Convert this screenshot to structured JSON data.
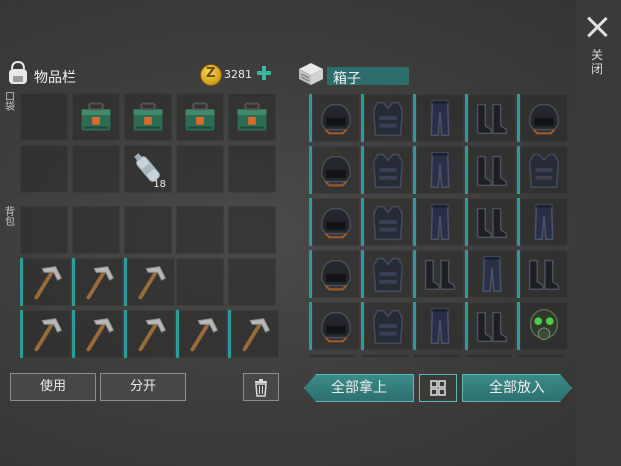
{
  "inventory": {
    "title": "物品栏",
    "coins": "3281",
    "pockets_label": "口袋",
    "backpack_label": "背包",
    "pocket_slots": [
      {
        "item": "empty"
      },
      {
        "item": "toolbox-icon"
      },
      {
        "item": "toolbox-icon"
      },
      {
        "item": "toolbox-icon"
      },
      {
        "item": "toolbox-icon"
      },
      {
        "item": "empty"
      },
      {
        "item": "empty"
      },
      {
        "item": "water-bottle-icon",
        "qty": "18"
      },
      {
        "item": "empty"
      },
      {
        "item": "empty"
      }
    ],
    "backpack_slots": [
      {
        "item": "empty"
      },
      {
        "item": "empty"
      },
      {
        "item": "empty"
      },
      {
        "item": "empty"
      },
      {
        "item": "empty"
      },
      {
        "item": "pickaxe-icon"
      },
      {
        "item": "pickaxe-icon"
      },
      {
        "item": "pickaxe-icon"
      },
      {
        "item": "empty"
      },
      {
        "item": "empty"
      },
      {
        "item": "pickaxe-icon"
      },
      {
        "item": "pickaxe-icon"
      },
      {
        "item": "pickaxe-icon"
      },
      {
        "item": "pickaxe-icon"
      },
      {
        "item": "pickaxe-icon"
      }
    ],
    "use_label": "使用",
    "split_label": "分开"
  },
  "box": {
    "title": "箱子",
    "slots": [
      {
        "item": "helmet-icon"
      },
      {
        "item": "vest-icon"
      },
      {
        "item": "pants-icon"
      },
      {
        "item": "boots-icon"
      },
      {
        "item": "helmet-icon"
      },
      {
        "item": "helmet-icon"
      },
      {
        "item": "vest-icon"
      },
      {
        "item": "pants-icon"
      },
      {
        "item": "boots-icon"
      },
      {
        "item": "vest-icon"
      },
      {
        "item": "helmet-icon"
      },
      {
        "item": "vest-icon"
      },
      {
        "item": "pants-icon"
      },
      {
        "item": "boots-icon"
      },
      {
        "item": "pants-icon"
      },
      {
        "item": "helmet-icon"
      },
      {
        "item": "vest-icon"
      },
      {
        "item": "boots-icon"
      },
      {
        "item": "pants-icon"
      },
      {
        "item": "boots-icon"
      },
      {
        "item": "helmet-icon"
      },
      {
        "item": "vest-icon"
      },
      {
        "item": "pants-icon"
      },
      {
        "item": "boots-icon"
      },
      {
        "item": "gas-mask-icon"
      }
    ],
    "take_all_label": "全部拿上",
    "put_all_label": "全部放入"
  },
  "close_label": "关闭",
  "colors": {
    "teal": "#2c9c9a",
    "coin": "#e3b429",
    "background": "#3f3f3e"
  }
}
